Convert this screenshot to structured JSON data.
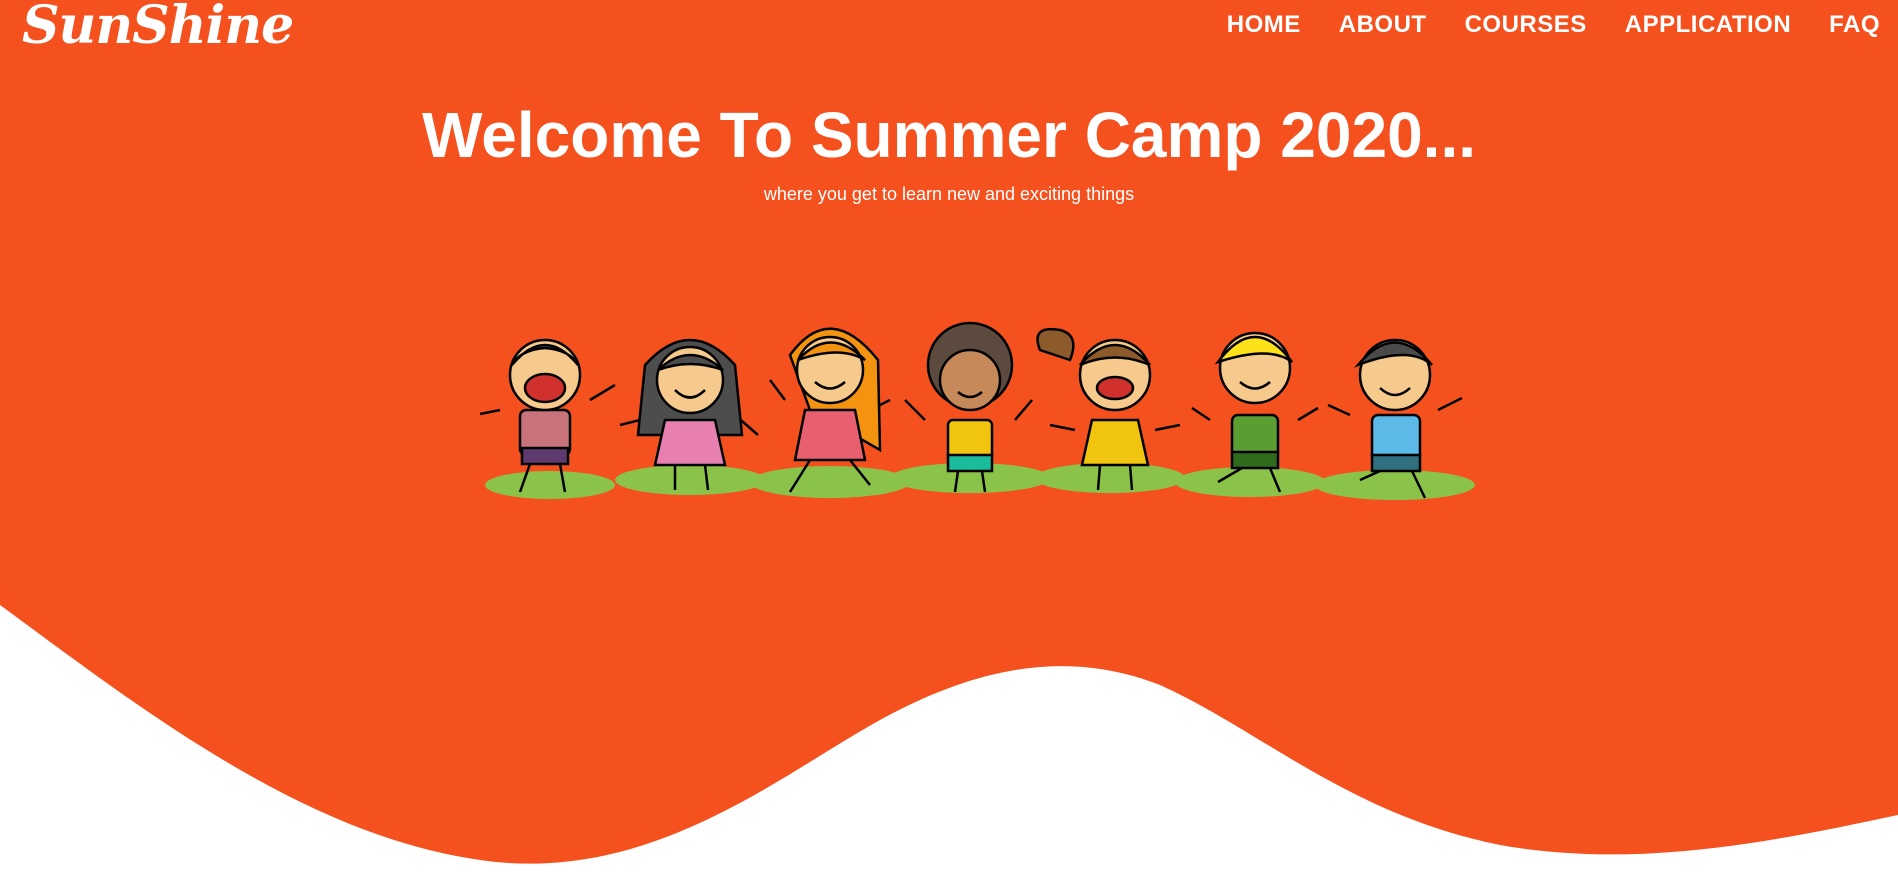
{
  "brand": {
    "logo_text": "SunShine"
  },
  "nav": {
    "items": [
      {
        "label": "HOME"
      },
      {
        "label": "ABOUT"
      },
      {
        "label": "COURSES"
      },
      {
        "label": "APPLICATION"
      },
      {
        "label": "FAQ"
      }
    ]
  },
  "hero": {
    "title": "Welcome To Summer Camp 2020...",
    "subtitle": "where you get to learn new and exciting things",
    "illustration": "kids-jumping-illustration"
  },
  "colors": {
    "hero_background": "#f5511e",
    "text": "#ffffff",
    "grass": "#8bc34a"
  }
}
